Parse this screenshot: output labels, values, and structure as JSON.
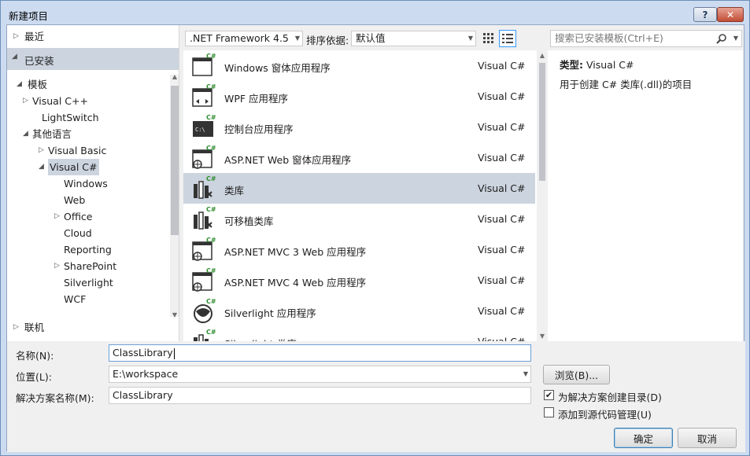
{
  "window": {
    "title": "新建项目",
    "help_label": "?",
    "close_label": "✕"
  },
  "left_tree": {
    "recent": "最近",
    "installed": "已安装",
    "templates": "模板",
    "items": [
      {
        "label": "Visual C++",
        "expander": "▷"
      },
      {
        "label": "LightSwitch",
        "expander": ""
      },
      {
        "label": "其他语言",
        "expander": "◢"
      },
      {
        "label": "Visual Basic",
        "expander": "▷"
      },
      {
        "label": "Visual C#",
        "expander": "◢"
      },
      {
        "label": "Windows",
        "expander": ""
      },
      {
        "label": "Web",
        "expander": ""
      },
      {
        "label": "Office",
        "expander": "▷"
      },
      {
        "label": "Cloud",
        "expander": ""
      },
      {
        "label": "Reporting",
        "expander": ""
      },
      {
        "label": "SharePoint",
        "expander": "▷"
      },
      {
        "label": "Silverlight",
        "expander": ""
      },
      {
        "label": "WCF",
        "expander": ""
      }
    ],
    "online": "联机"
  },
  "toolbar": {
    "framework": ".NET Framework 4.5",
    "sort_label": "排序依据:",
    "sort_value": "默认值",
    "search_placeholder": "搜索已安装模板(Ctrl+E)"
  },
  "templates": [
    {
      "name": "Windows 窗体应用程序",
      "lang": "Visual C#"
    },
    {
      "name": "WPF 应用程序",
      "lang": "Visual C#"
    },
    {
      "name": "控制台应用程序",
      "lang": "Visual C#"
    },
    {
      "name": "ASP.NET Web 窗体应用程序",
      "lang": "Visual C#"
    },
    {
      "name": "类库",
      "lang": "Visual C#"
    },
    {
      "name": "可移植类库",
      "lang": "Visual C#"
    },
    {
      "name": "ASP.NET MVC 3 Web 应用程序",
      "lang": "Visual C#"
    },
    {
      "name": "ASP.NET MVC 4 Web 应用程序",
      "lang": "Visual C#"
    },
    {
      "name": "Silverlight 应用程序",
      "lang": "Visual C#"
    },
    {
      "name": "Silverlight 类库",
      "lang": "Visual C#"
    }
  ],
  "details": {
    "type_label": "类型:",
    "type_value": "Visual C#",
    "description": "用于创建 C# 类库(.dll)的项目"
  },
  "form": {
    "name_label": "名称(N):",
    "name_value": "ClassLibrary",
    "location_label": "位置(L):",
    "location_value": "E:\\workspace",
    "solution_label": "解决方案名称(M):",
    "solution_value": "ClassLibrary",
    "browse": "浏览(B)...",
    "create_dir": "为解决方案创建目录(D)",
    "create_dir_checked": true,
    "source_control": "添加到源代码管理(U)",
    "source_control_checked": false,
    "ok": "确定",
    "cancel": "取消"
  },
  "colors": {
    "accent_green": "#2e8b2e",
    "selection": "#ccd4df",
    "focus_border": "#3399ff"
  }
}
